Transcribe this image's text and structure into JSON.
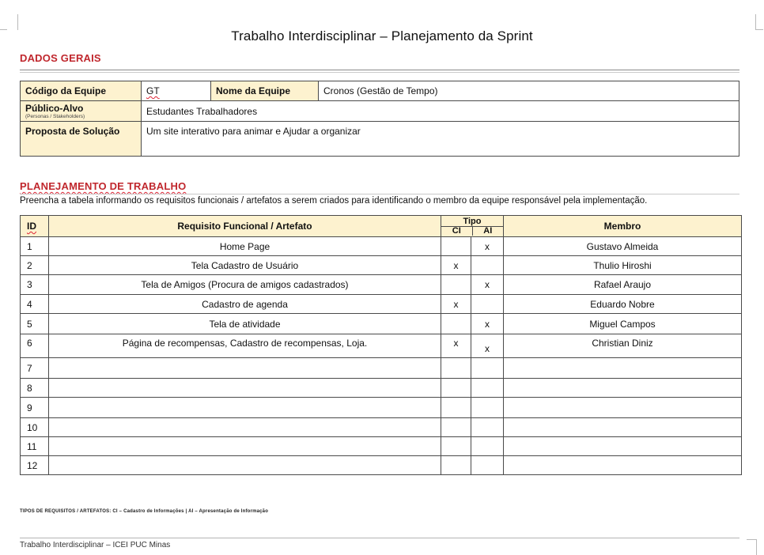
{
  "document": {
    "title": "Trabalho Interdisciplinar – Planejamento da Sprint"
  },
  "dados_gerais": {
    "heading": "DADOS GERAIS",
    "codigo_label": "Código da Equipe",
    "codigo_value": "GT",
    "nome_label": "Nome da Equipe",
    "nome_value": "Cronos (Gestão de Tempo)",
    "publico_label": "Público-Alvo",
    "publico_sublabel": "(Personas / Stakeholders)",
    "publico_value": "Estudantes Trabalhadores",
    "proposta_label": "Proposta de Solução",
    "proposta_value": "Um site interativo para animar e Ajudar a organizar"
  },
  "planejamento": {
    "heading": "PLANEJAMENTO DE TRABALHO",
    "instructions": "Preencha a tabela informando os requisitos funcionais / artefatos a serem criados para identificando o membro da equipe responsável pela implementação.",
    "columns": {
      "id": "ID",
      "requisito": "Requisito Funcional / Artefato",
      "tipo": "Tipo",
      "ci": "CI",
      "ai": "AI",
      "membro": "Membro"
    },
    "rows": [
      {
        "id": "1",
        "requisito": "Home Page",
        "ci": "",
        "ai": "x",
        "membro": "Gustavo Almeida"
      },
      {
        "id": "2",
        "requisito": "Tela Cadastro de Usuário",
        "ci": "x",
        "ai": "",
        "membro": "Thulio Hiroshi"
      },
      {
        "id": "3",
        "requisito": "Tela de Amigos (Procura de amigos cadastrados)",
        "ci": "",
        "ai": "x",
        "membro": "Rafael Araujo"
      },
      {
        "id": "4",
        "requisito": "Cadastro de agenda",
        "ci": "x",
        "ai": "",
        "membro": "Eduardo Nobre"
      },
      {
        "id": "5",
        "requisito": "Tela de atividade",
        "ci": "",
        "ai": "x",
        "membro": "Miguel Campos"
      },
      {
        "id": "6",
        "requisito": "Página de recompensas, Cadastro de recompensas, Loja.",
        "ci": "x",
        "ai": "x",
        "membro": "Christian Diniz"
      },
      {
        "id": "7",
        "requisito": "",
        "ci": "",
        "ai": "",
        "membro": ""
      },
      {
        "id": "8",
        "requisito": "",
        "ci": "",
        "ai": "",
        "membro": ""
      },
      {
        "id": "9",
        "requisito": "",
        "ci": "",
        "ai": "",
        "membro": ""
      },
      {
        "id": "10",
        "requisito": "",
        "ci": "",
        "ai": "",
        "membro": ""
      },
      {
        "id": "11",
        "requisito": "",
        "ci": "",
        "ai": "",
        "membro": ""
      },
      {
        "id": "12",
        "requisito": "",
        "ci": "",
        "ai": "",
        "membro": ""
      }
    ],
    "footnote": "TIPOS DE REQUISITOS / ARTEFATOS: CI – Cadastro de Informações | AI – Apresentação de Informação"
  },
  "footer": {
    "text": "Trabalho Interdisciplinar – ICEI PUC Minas"
  }
}
